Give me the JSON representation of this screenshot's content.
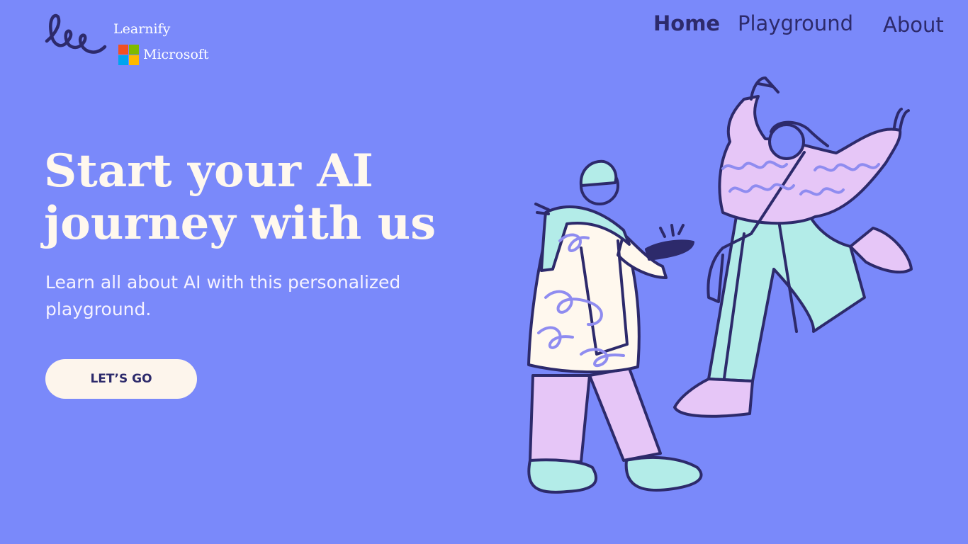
{
  "brand": {
    "name": "Learnify",
    "partner": "Microsoft",
    "logo_icon": "handwritten-lee-logo-icon",
    "partner_icon": "microsoft-logo-icon",
    "partner_colors": [
      "#f25022",
      "#7fba00",
      "#00a4ef",
      "#ffb900"
    ]
  },
  "nav": {
    "items": [
      {
        "label": "Home",
        "active": true
      },
      {
        "label": "Playground",
        "active": false
      },
      {
        "label": "About",
        "active": false
      }
    ]
  },
  "hero": {
    "title": "Start your AI journey with us",
    "subtitle": "Learn all about AI with this personalized playground.",
    "cta_label": "LET’S GO",
    "illustration": "two-people-celebrating-illustration"
  },
  "colors": {
    "background": "#7a89fa",
    "nav_text": "#2d2a6b",
    "title_text": "#fff8ee",
    "button_bg": "#fdf5ec"
  }
}
